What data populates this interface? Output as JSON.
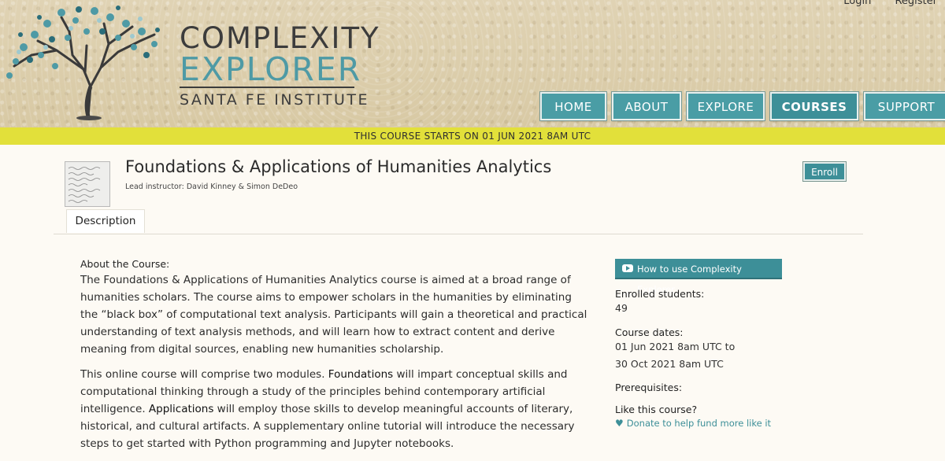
{
  "header": {
    "logo": {
      "line1": "COMPLEXITY",
      "line2": "EXPLORER",
      "line3": "SANTA FE INSTITUTE"
    },
    "top_links": {
      "login": "Login",
      "register": "Register"
    },
    "nav": [
      "HOME",
      "ABOUT",
      "EXPLORE",
      "COURSES",
      "SUPPORT"
    ],
    "active_nav": "COURSES"
  },
  "banner": "THIS COURSE STARTS ON 01 JUN 2021 8AM UTC",
  "course": {
    "title": "Foundations & Applications of Humanities Analytics",
    "instructor": "Lead instructor: David Kinney & Simon DeDeo",
    "enroll_label": "Enroll",
    "tab": "Description"
  },
  "about": {
    "heading": "About the Course:",
    "para1": "The Foundations & Applications of Humanities Analytics course is aimed at a broad range of humanities scholars. The course aims to empower scholars in the humanities by eliminating the “black box” of computational text analysis. Participants will gain a theoretical and practical understanding of text analysis methods, and will learn how to extract content and derive meaning from digital sources, enabling new humanities scholarship.",
    "para2_a": "This online course will comprise two modules. ",
    "para2_foundations": "Foundations",
    "para2_b": " will impart conceptual skills and computational thinking through a study of the principles behind contemporary artificial intelligence. ",
    "para2_applications": "Applications",
    "para2_c": " will employ those skills to develop meaningful accounts of literary, historical, and cultural artifacts. A supplementary online tutorial will introduce the necessary steps to get started with Python programming and Jupyter notebooks."
  },
  "side": {
    "how_to_label": "How to use Complexity Explorer",
    "enrolled_label": "Enrolled students:",
    "enrolled_value": "49",
    "dates_label": "Course dates:",
    "dates_start": "01 Jun 2021 8am UTC to",
    "dates_end": "30 Oct 2021 8am UTC",
    "prereq_label": "Prerequisites:",
    "like_label": "Like this course?",
    "donate_label": "Donate to help fund more like it"
  },
  "colors": {
    "accent": "#3d8f98",
    "banner": "#e2e03a",
    "header_bg": "#d8c9a4"
  }
}
